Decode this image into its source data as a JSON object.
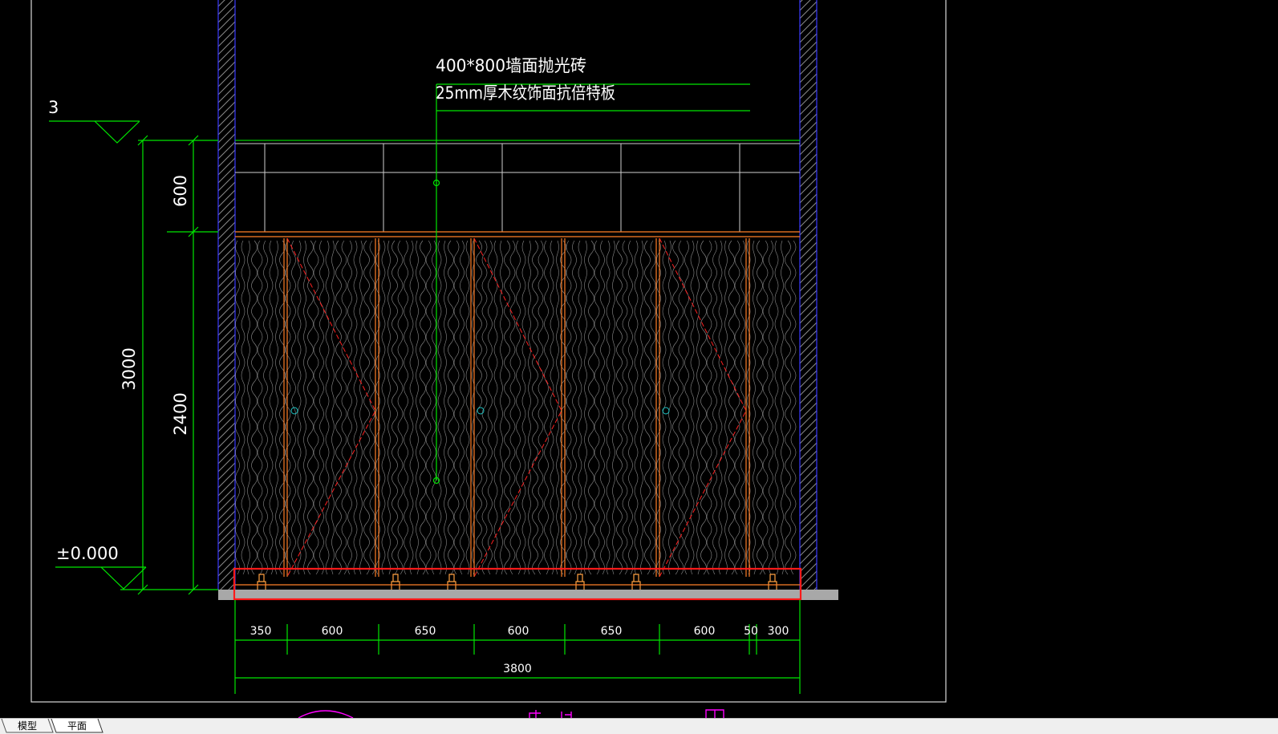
{
  "annotations": {
    "material_1": "400*800墙面抛光砖",
    "material_2": "25mm厚木纹饰面抗倍特板"
  },
  "levels": {
    "top_level": "3",
    "base_level": "±0.000"
  },
  "vertical_dims": {
    "total": "3000",
    "upper": "600",
    "lower": "2400"
  },
  "horizontal_dims": {
    "segments": [
      "350",
      "600",
      "650",
      "600",
      "650",
      "600",
      "50",
      "300"
    ],
    "total": "3800"
  },
  "tabs": [
    {
      "label": "模型",
      "active": false
    },
    {
      "label": "平面",
      "active": true
    }
  ],
  "colors": {
    "background": "#000000",
    "dimension": "#00ff00",
    "panel": "#ff7f27",
    "highlight": "#ff0000",
    "wall_hatch": "#7f7f7f",
    "title": "#ff00ff"
  }
}
